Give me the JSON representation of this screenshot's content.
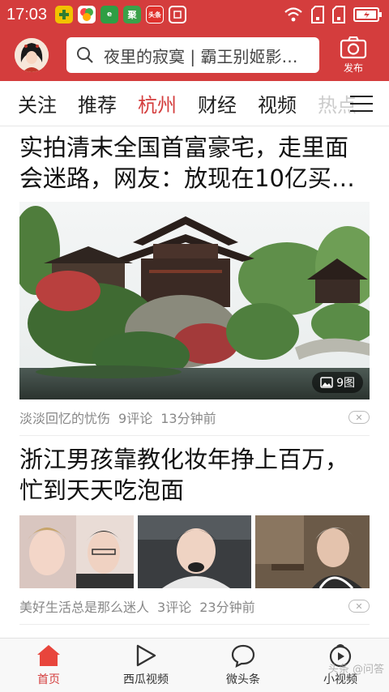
{
  "status_bar": {
    "time": "17:03",
    "apps": [
      {
        "icon": "app-cross-icon",
        "color": "#f2c200",
        "text": ""
      },
      {
        "icon": "app-colorful-icon",
        "color": "#5ab55a",
        "text": ""
      },
      {
        "icon": "app-e-icon",
        "color": "#2f9e44",
        "text": "e"
      },
      {
        "icon": "app-news-icon",
        "color": "#3aa14a",
        "text": "聚"
      },
      {
        "icon": "toutiao-icon",
        "color": "#e0322e",
        "text": "头条"
      },
      {
        "icon": "screenshot-icon",
        "color": "#d43d3d",
        "text": ""
      }
    ]
  },
  "header": {
    "search_text": "夜里的寂寞 | 霸王别姬影…",
    "publish_label": "发布"
  },
  "tabs": [
    {
      "label": "关注",
      "state": "normal"
    },
    {
      "label": "推荐",
      "state": "normal"
    },
    {
      "label": "杭州",
      "state": "active"
    },
    {
      "label": "财经",
      "state": "normal"
    },
    {
      "label": "视频",
      "state": "normal"
    },
    {
      "label": "热点",
      "state": "faded"
    }
  ],
  "feed": {
    "articles": [
      {
        "title": "实拍清末全国首富豪宅，走里面会迷路，网友：放现在10亿买…",
        "image_count": "9图",
        "source": "淡淡回忆的忧伤",
        "comments": "9评论",
        "time": "13分钟前"
      },
      {
        "title": "浙江男孩靠教化妆年挣上百万，忙到天天吃泡面",
        "source": "美好生活总是那么迷人",
        "comments": "3评论",
        "time": "23分钟前"
      }
    ]
  },
  "bottom_nav": [
    {
      "label": "首页",
      "icon": "home-icon",
      "active": true
    },
    {
      "label": "西瓜视频",
      "icon": "play-icon",
      "active": false
    },
    {
      "label": "微头条",
      "icon": "chat-bubble-icon",
      "active": false
    },
    {
      "label": "小视频",
      "icon": "small-video-icon",
      "active": false
    }
  ],
  "watermark": "头条 @问答"
}
